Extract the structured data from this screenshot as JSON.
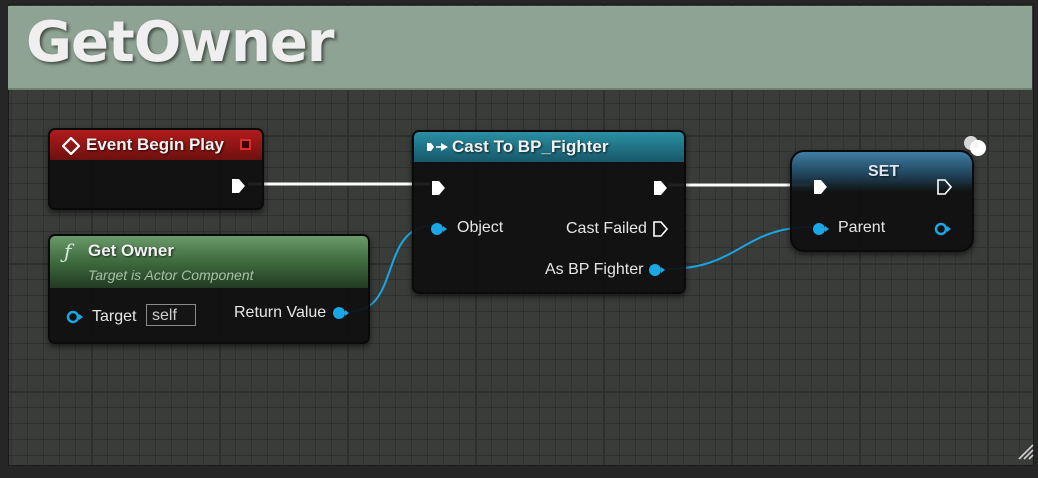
{
  "comment": {
    "title": "GetOwner"
  },
  "nodes": {
    "event_begin_play": {
      "title": "Event Begin Play"
    },
    "get_owner": {
      "title": "Get Owner",
      "subtitle": "Target is Actor Component",
      "function_glyph": "ƒ",
      "target_label": "Target",
      "target_value": "self",
      "return_label": "Return Value"
    },
    "cast": {
      "title": "Cast To BP_Fighter",
      "object_label": "Object",
      "cast_failed_label": "Cast Failed",
      "as_label": "As BP Fighter"
    },
    "set": {
      "title": "SET",
      "parent_label": "Parent"
    }
  },
  "colors": {
    "exec": "#ffffff",
    "object_pin": "#19a7e6",
    "event_header": "#8c1414",
    "function_header": "#4f7a4f",
    "cast_header": "#1d6b7d",
    "set_header": "#2b5570"
  },
  "icons": [
    "event-diamond-icon",
    "delegate-square-icon",
    "function-icon",
    "cast-exec-icon",
    "variable-ball-icon",
    "resize-grip-icon"
  ]
}
